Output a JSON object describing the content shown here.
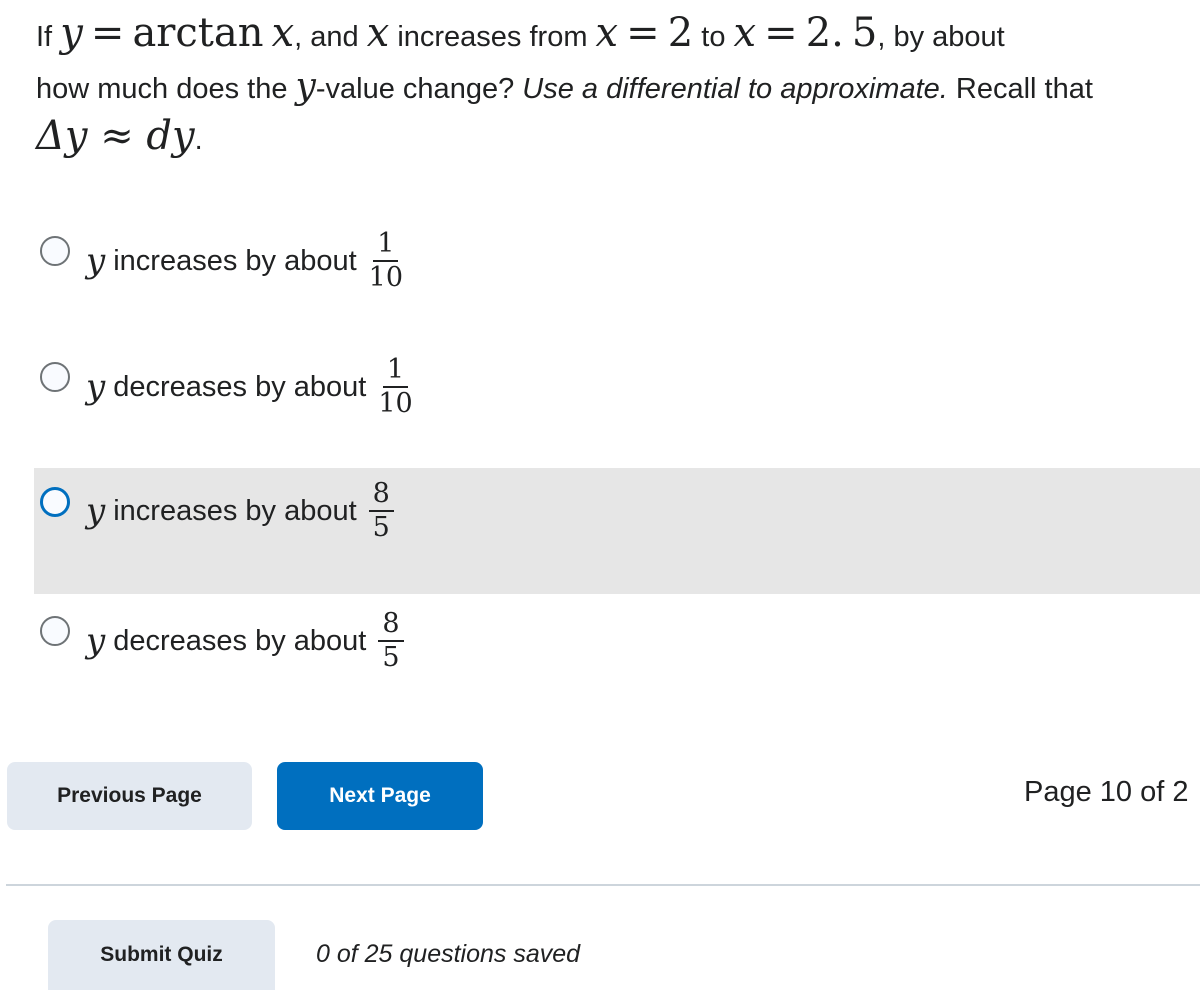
{
  "question": {
    "prefix_if": "If",
    "var_y": "y",
    "equals": "=",
    "func": "arctan",
    "var_x": "x",
    "text_and": ", and",
    "text_increases_from": "increases from",
    "x_start": "2",
    "text_to": "to",
    "x_end": "2. 5",
    "text_by_about": ", by about",
    "line2_start": "how much does the",
    "line2_mid": "-value change?",
    "instruction_italic": "Use a differential to approximate.",
    "line2_end": "Recall that",
    "recall_formula": "Δy ≈ dy",
    "recall_period": "."
  },
  "options": [
    {
      "var": "y",
      "text": "increases by about",
      "numerator": "1",
      "denominator": "10",
      "selected": false,
      "hovered": false
    },
    {
      "var": "y",
      "text": "decreases by about",
      "numerator": "1",
      "denominator": "10",
      "selected": false,
      "hovered": false
    },
    {
      "var": "y",
      "text": "increases by about",
      "numerator": "8",
      "denominator": "5",
      "selected": false,
      "hovered": true
    },
    {
      "var": "y",
      "text": "decreases by about",
      "numerator": "8",
      "denominator": "5",
      "selected": false,
      "hovered": false
    }
  ],
  "navigation": {
    "previous_label": "Previous Page",
    "next_label": "Next Page",
    "page_indicator": "Page 10 of 2"
  },
  "footer": {
    "submit_label": "Submit Quiz",
    "saved_status": "0 of 25 questions saved"
  },
  "colors": {
    "primary": "#006fbf",
    "secondary_button": "#e3e9f1",
    "hover_row": "#e6e6e6"
  }
}
